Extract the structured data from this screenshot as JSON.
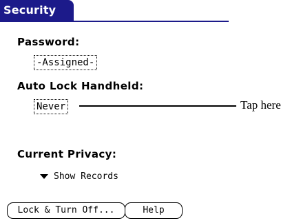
{
  "form": {
    "title": "Security",
    "password_label": "Password:",
    "password_value": "-Assigned-",
    "auto_lock_label": "Auto Lock Handheld:",
    "auto_lock_value": "Never",
    "current_privacy_label": "Current Privacy:",
    "privacy_selected": "Show Records",
    "privacy_trigger_icon": "triangle-down-icon"
  },
  "buttons": {
    "lock_turn_off": "Lock & Turn Off...",
    "help": "Help"
  },
  "callout": {
    "text": "Tap here"
  },
  "colors": {
    "title_bar": "#1c1a8a",
    "title_text": "#ffffff",
    "background": "#ffffff",
    "text": "#000000"
  }
}
